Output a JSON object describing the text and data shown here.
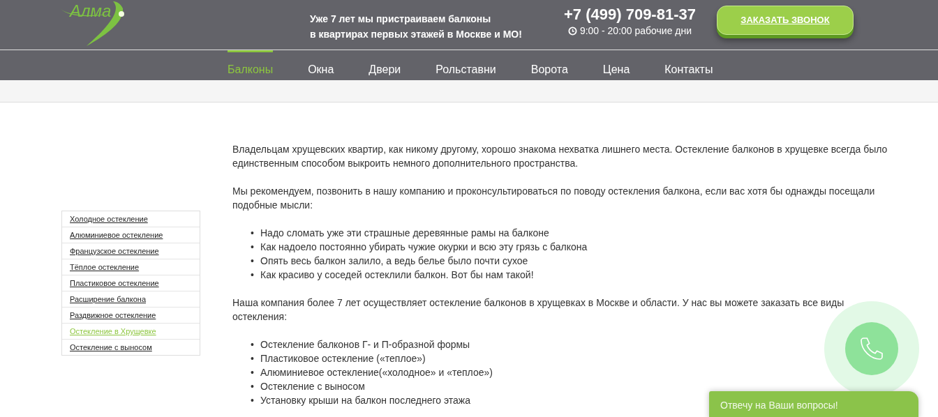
{
  "header": {
    "logo": "Алма",
    "tagline_lines": [
      "Уже 7 лет мы пристраиваем балконы",
      "в квартирах первых этажей в Москве и МО!"
    ],
    "phone": "+7 (499) 709-81-37",
    "hours": "9:00 - 20:00 рабочие дни",
    "callback_button": "ЗАКАЗАТЬ ЗВОНОК"
  },
  "nav": [
    {
      "label": "Балконы",
      "selected": true
    },
    {
      "label": "Окна",
      "selected": false
    },
    {
      "label": "Двери",
      "selected": false
    },
    {
      "label": "Рольставни",
      "selected": false
    },
    {
      "label": "Ворота",
      "selected": false
    },
    {
      "label": "Цена",
      "selected": false
    },
    {
      "label": "Контакты",
      "selected": false
    }
  ],
  "sidebar": [
    {
      "label": "Холодное остекление",
      "selected": false
    },
    {
      "label": "Алюминиевое остекление",
      "selected": false
    },
    {
      "label": "Французское остекление",
      "selected": false
    },
    {
      "label": "Тёплое остекление",
      "selected": false
    },
    {
      "label": "Пластиковое остекление",
      "selected": false
    },
    {
      "label": "Расширение балкона",
      "selected": false
    },
    {
      "label": "Раздвижное остекление",
      "selected": false
    },
    {
      "label": "Остекление в Хрущевке",
      "selected": true
    },
    {
      "label": "Остекление с выносом",
      "selected": false
    }
  ],
  "content": [
    {
      "kind": "paragraph",
      "text": "Владельцам хрущевских квартир, как никому другому, хорошо знакома нехватка лишнего места. Остекление балконов в хрущевке всегда было единственным способом выкроить немного дополнительного пространства."
    },
    {
      "kind": "paragraph",
      "text": "Мы рекомендуем, позвонить в нашу компанию и проконсультироваться по поводу остекления балкона, если вас хотя бы однажды посещали подобные мысли:"
    },
    {
      "kind": "list",
      "marker": "•",
      "items": [
        "Надо сломать уже эти страшные деревянные рамы на балконе",
        "Как надоело постоянно убирать чужие окурки и всю эту грязь с балкона",
        "Опять весь балкон залило, а ведь белье было почти сухое",
        "Как красиво у соседей остеклили балкон. Вот бы нам такой!"
      ]
    },
    {
      "kind": "paragraph",
      "text": "Наша компания более 7 лет осуществляет остекление балконов в хрущевках в Москве и области. У нас вы можете заказать все виды остекления:"
    },
    {
      "kind": "list",
      "marker": "•",
      "items": [
        "Остекление балконов Г- и П-образной формы",
        "Пластиковое остекление («теплое»)",
        "Алюминиевое остекление(«холодное» и «теплое»)",
        "Остекление с выносом",
        "Установку крыши на балкон последнего этажа"
      ]
    }
  ],
  "chat_widget": {
    "label": "Отвечу на Ваши вопросы!"
  }
}
